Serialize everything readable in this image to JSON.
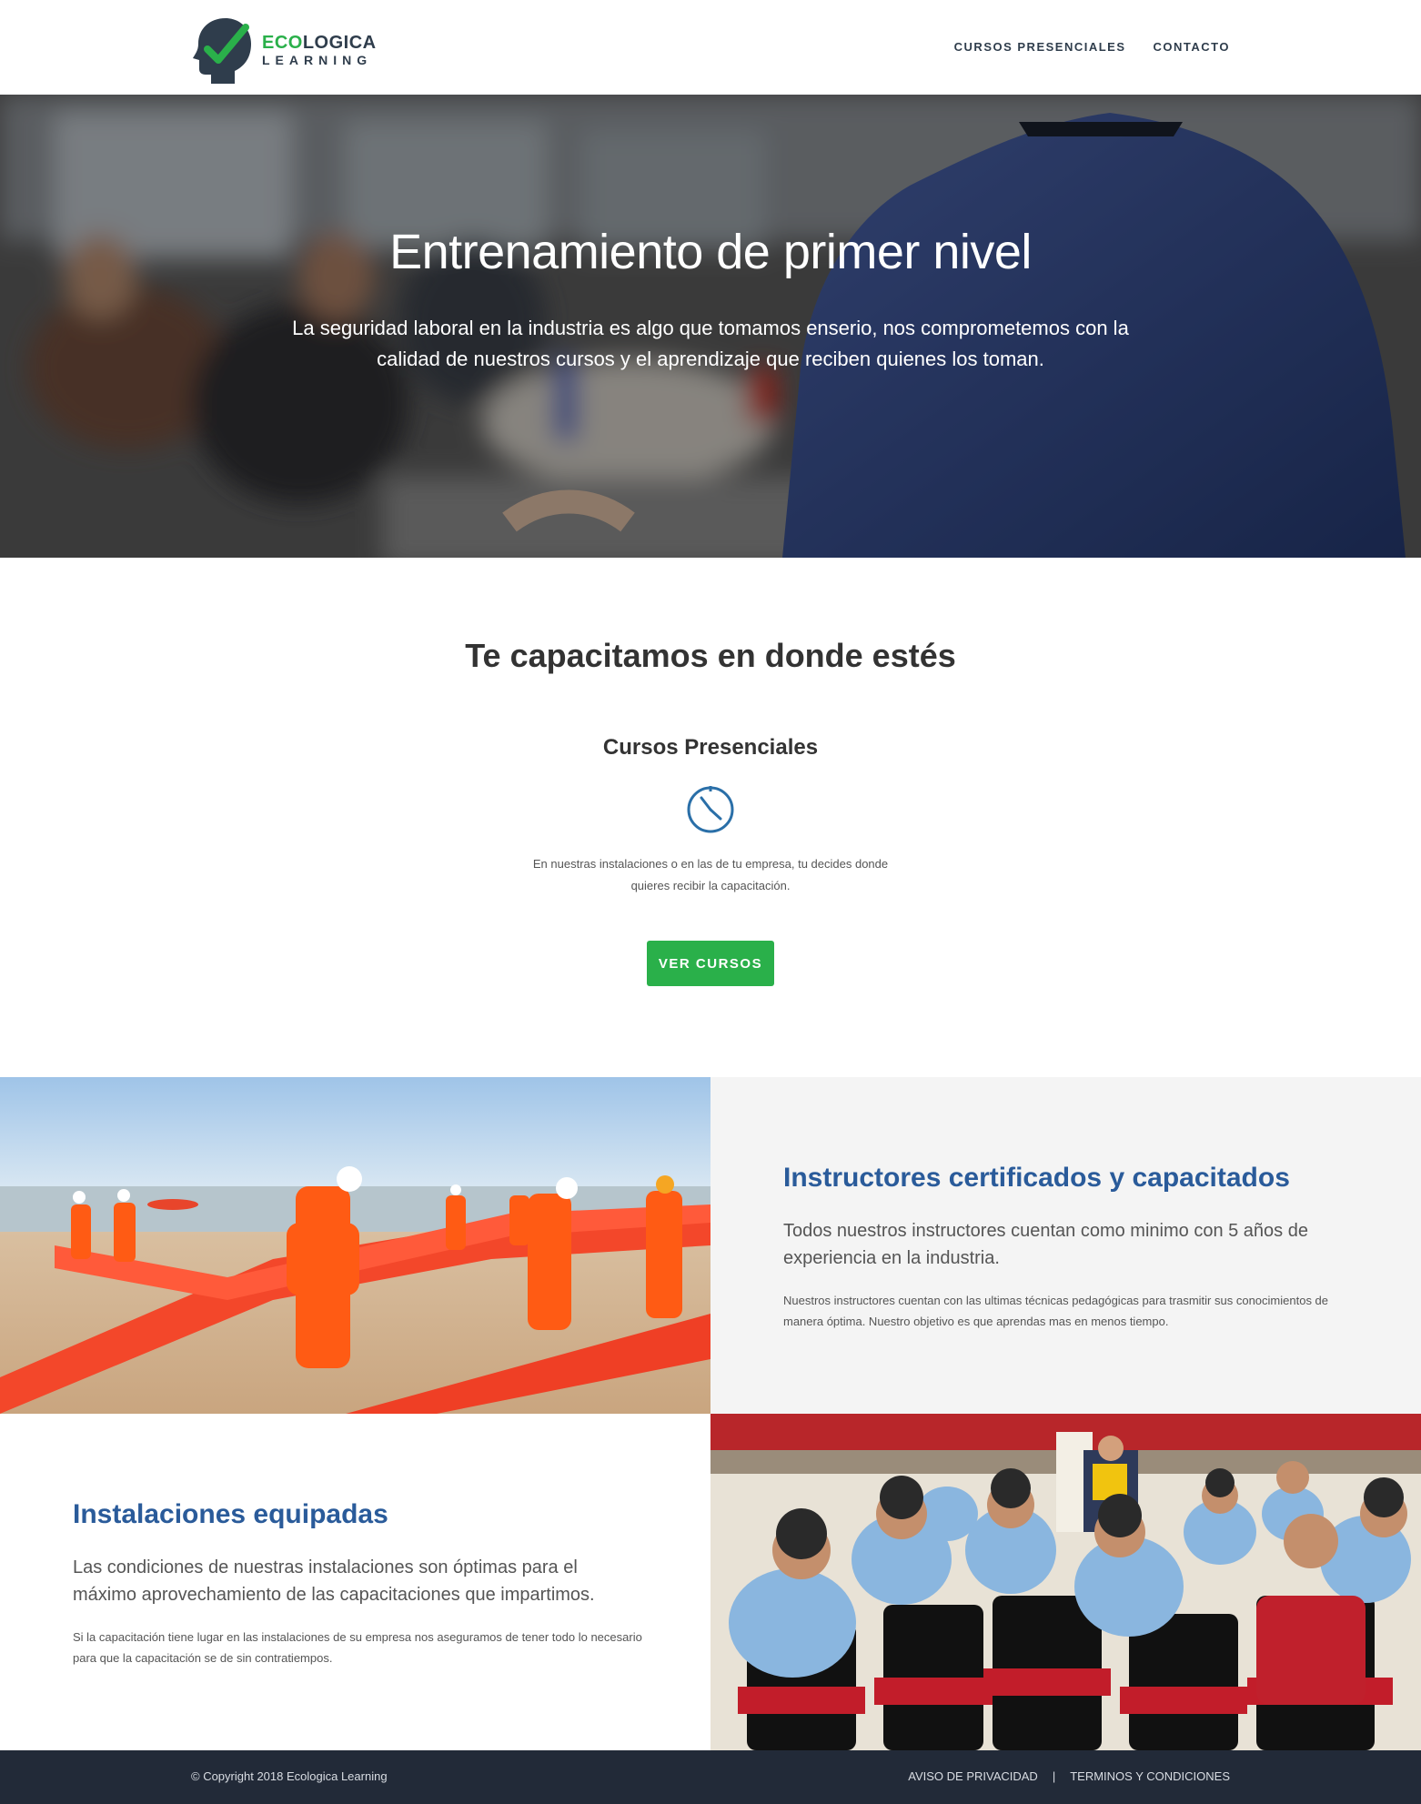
{
  "brand": {
    "word1_a": "ECO",
    "word1_b": "LOGICA",
    "word2": "LEARNING",
    "accent": "#2ab04a",
    "dark": "#2f3d4c"
  },
  "nav": {
    "items": [
      {
        "label": "CURSOS PRESENCIALES"
      },
      {
        "label": "CONTACTO"
      }
    ]
  },
  "hero": {
    "title": "Entrenamiento de primer nivel",
    "text": "La seguridad laboral en la industria es algo que tomamos enserio, nos comprometemos con la calidad de nuestros cursos y el aprendizaje que reciben quienes los toman."
  },
  "training": {
    "title": "Te capacitamos en donde estés",
    "subtitle": "Cursos Presenciales",
    "icon": "stopwatch-icon",
    "text": "En nuestras instalaciones o en las de tu empresa, tu decides donde quieres recibir la capacitación.",
    "button": "VER CURSOS"
  },
  "instructors": {
    "title": "Instructores certificados y capacitados",
    "lead": "Todos nuestros instructores cuentan como minimo con 5 años de experiencia en la industria.",
    "text": "Nuestros instructores cuentan con las ultimas técnicas pedagógicas para trasmitir sus conocimientos de manera óptima. Nuestro objetivo es que aprendas mas en menos tiempo."
  },
  "facilities": {
    "title": "Instalaciones equipadas",
    "lead": "Las condiciones de nuestras instalaciones son óptimas para el máximo aprovechamiento de las capacitaciones que impartimos.",
    "text": "Si la capacitación tiene lugar en las instalaciones de su empresa nos aseguramos de tener todo lo necesario para que la capacitación se de sin contratiempos."
  },
  "footer": {
    "copyright": "© Copyright 2018 Ecologica Learning",
    "privacy": "AVISO DE PRIVACIDAD",
    "separator": "|",
    "terms": "TERMINOS Y CONDICIONES"
  }
}
